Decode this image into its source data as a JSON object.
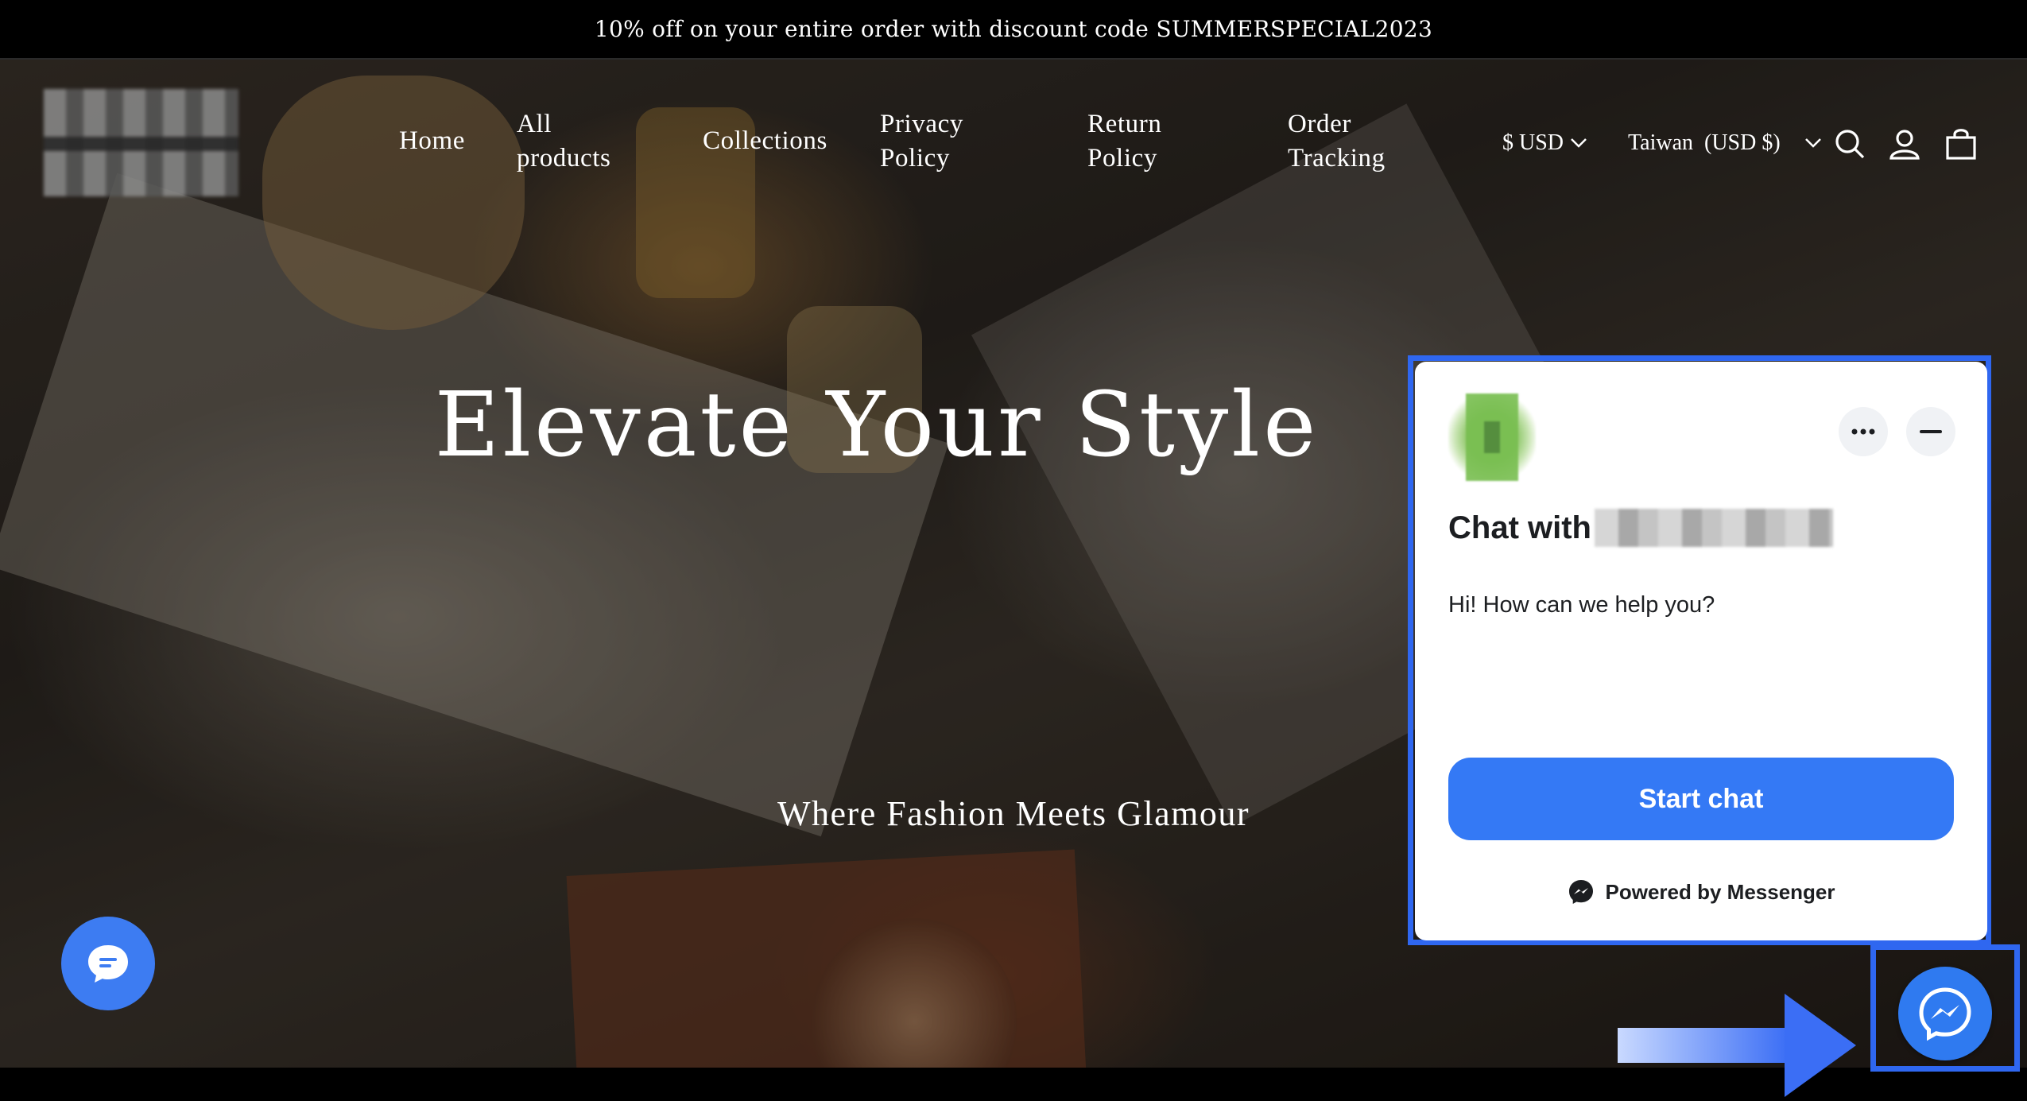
{
  "announcement": "10% off on your entire order with discount code SUMMERSPECIAL2023",
  "nav": {
    "items": [
      {
        "label": "Home"
      },
      {
        "label": "All\nproducts"
      },
      {
        "label": "Collections"
      },
      {
        "label": "Privacy\nPolicy"
      },
      {
        "label": "Return\nPolicy"
      },
      {
        "label": "Order\nTracking"
      }
    ],
    "currency": "$ USD",
    "region": "Taiwan  (USD $)",
    "icons": [
      "search-icon",
      "account-icon",
      "cart-icon"
    ]
  },
  "hero": {
    "headline": "Elevate Your Style",
    "subheadline": "Where Fashion Meets Glamour"
  },
  "chat_widget": {
    "title_prefix": "Chat with",
    "greeting": "Hi! How can we help you?",
    "start_button": "Start chat",
    "powered_by": "Powered by Messenger",
    "icons": [
      "more-options-icon",
      "minimize-icon",
      "messenger-logo-icon"
    ]
  },
  "colors": {
    "accent": "#3479f5",
    "highlight_border": "#2f67f0",
    "announcement_bg": "#000000"
  }
}
